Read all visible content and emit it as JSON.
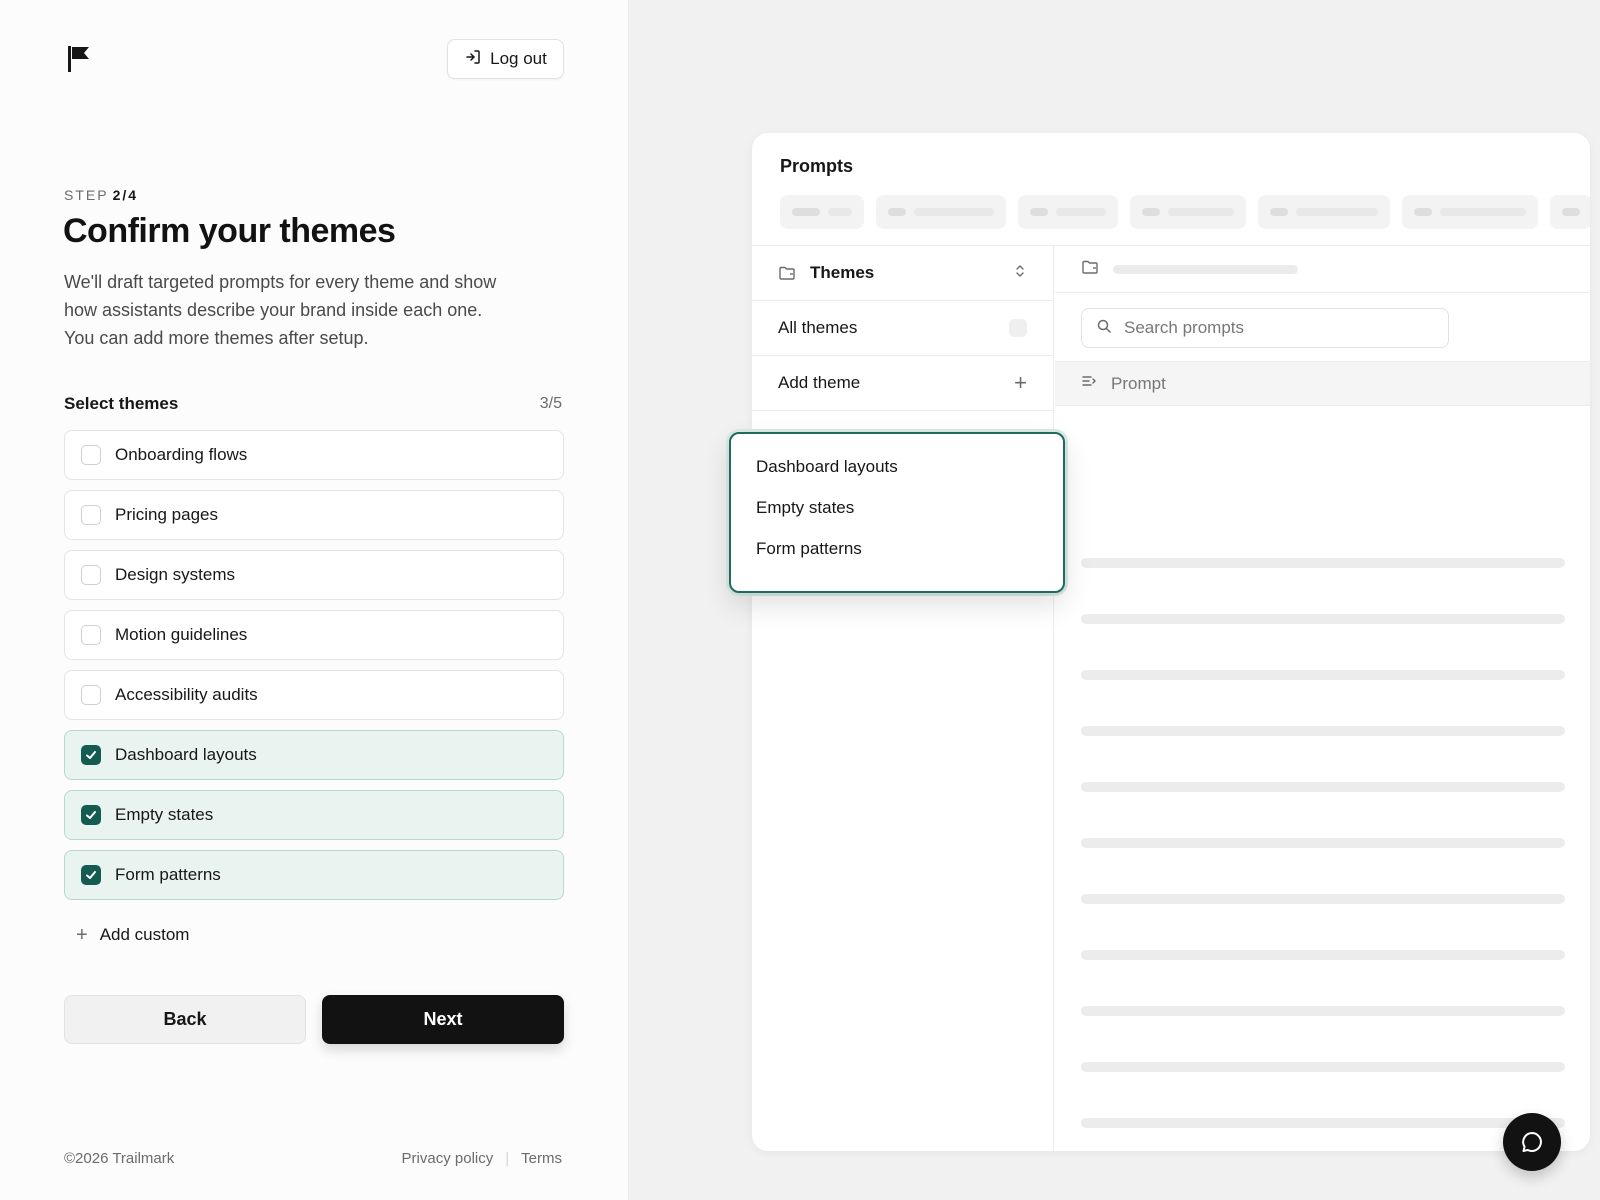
{
  "header": {
    "logout_label": "Log out"
  },
  "step": {
    "prefix": "STEP",
    "value": "2/4"
  },
  "title": "Confirm your themes",
  "description": "We'll draft targeted prompts for every theme and show how assistants describe your brand inside each one. You can add more themes after setup.",
  "select": {
    "label": "Select themes",
    "count": "3/5"
  },
  "themes": [
    {
      "label": "Onboarding flows",
      "checked": false
    },
    {
      "label": "Pricing pages",
      "checked": false
    },
    {
      "label": "Design systems",
      "checked": false
    },
    {
      "label": "Motion guidelines",
      "checked": false
    },
    {
      "label": "Accessibility audits",
      "checked": false
    },
    {
      "label": "Dashboard layouts",
      "checked": true
    },
    {
      "label": "Empty states",
      "checked": true
    },
    {
      "label": "Form patterns",
      "checked": true
    }
  ],
  "add_custom_label": "Add custom",
  "buttons": {
    "back": "Back",
    "next": "Next"
  },
  "footer": {
    "copyright": "©2026 Trailmark",
    "privacy": "Privacy policy",
    "terms": "Terms"
  },
  "preview": {
    "title": "Prompts",
    "sidebar": {
      "header": "Themes",
      "all_themes": "All themes",
      "add_theme": "Add theme"
    },
    "search_placeholder": "Search prompts",
    "column_header": "Prompt",
    "dropdown_options": [
      "Dashboard layouts",
      "Empty states",
      "Form patterns"
    ]
  },
  "colors": {
    "accent": "#145c52",
    "checked_bg": "#e9f4f1",
    "primary_button": "#121212"
  }
}
